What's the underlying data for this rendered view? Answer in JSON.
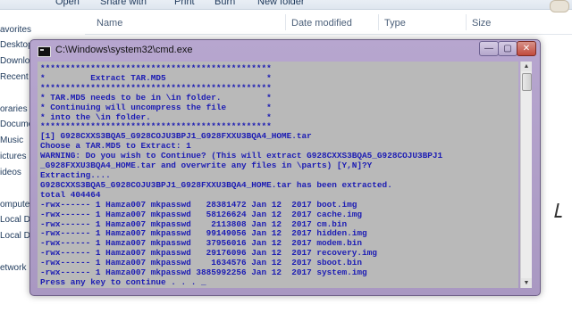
{
  "explorer": {
    "toolbar": {
      "open": "Open",
      "share_with": "Share with",
      "print": "Print",
      "burn": "Burn",
      "new_folder": "New folder"
    },
    "columns": {
      "name": "Name",
      "date_modified": "Date modified",
      "type": "Type",
      "size": "Size"
    },
    "nav": [
      "avorites",
      "Desktop",
      "Downloa",
      "Recent P",
      "oraries",
      "Docume",
      "Music",
      "ictures",
      "ideos",
      "omputer",
      "Local Di",
      "Local Di",
      "etwork"
    ]
  },
  "cmd": {
    "title": "C:\\Windows\\system32\\cmd.exe",
    "lines": [
      "**********************************************",
      "*         Extract TAR.MD5                    *",
      "**********************************************",
      "* TAR.MD5 needs to be in \\in folder.         *",
      "* Continuing will uncompress the file        *",
      "* into the \\in folder.                       *",
      "**********************************************",
      "[1] G928CXXS3BQA5_G928COJU3BPJ1_G928FXXU3BQA4_HOME.tar",
      "Choose a TAR.MD5 to Extract: 1",
      "WARNING: Do you wish to Continue? (This will extract G928CXXS3BQA5_G928COJU3BPJ1",
      "_G928FXXU3BQA4_HOME.tar and overwrite any files in \\parts) [Y,N]?Y",
      "Extracting....",
      "G928CXXS3BQA5_G928COJU3BPJ1_G928FXXU3BQA4_HOME.tar has been extracted.",
      "total 404464",
      "-rwx------ 1 Hamza007 mkpasswd   28381472 Jan 12  2017 boot.img",
      "-rwx------ 1 Hamza007 mkpasswd   58126624 Jan 12  2017 cache.img",
      "-rwx------ 1 Hamza007 mkpasswd    2113808 Jan 12  2017 cm.bin",
      "-rwx------ 1 Hamza007 mkpasswd   99149056 Jan 12  2017 hidden.img",
      "-rwx------ 1 Hamza007 mkpasswd   37956016 Jan 12  2017 modem.bin",
      "-rwx------ 1 Hamza007 mkpasswd   29176096 Jan 12  2017 recovery.img",
      "-rwx------ 1 Hamza007 mkpasswd    1634576 Jan 12  2017 sboot.bin",
      "-rwx------ 1 Hamza007 mkpasswd 3885992256 Jan 12  2017 system.img",
      "Press any key to continue . . . _"
    ],
    "buttons": {
      "minimize": "—",
      "maximize": "▢",
      "close": "✕"
    }
  }
}
